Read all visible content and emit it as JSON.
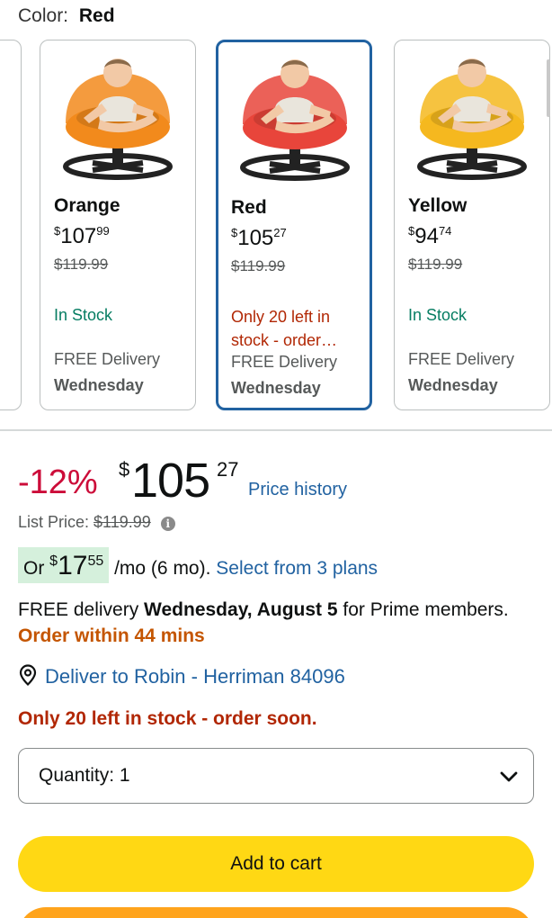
{
  "color_selector": {
    "label": "Color:",
    "selected": "Red"
  },
  "variants": [
    {
      "name": "Orange",
      "price_whole": "107",
      "price_frac": "99",
      "list_price": "$119.99",
      "stock": "In Stock",
      "delivery": "FREE Delivery",
      "day": "Wednesday",
      "seat_color": "#f28a1c"
    },
    {
      "name": "Red",
      "price_whole": "105",
      "price_frac": "27",
      "list_price": "$119.99",
      "stock": "Only 20 left in stock - order…",
      "delivery": "FREE Delivery",
      "day": "Wednesday",
      "seat_color": "#e8453b"
    },
    {
      "name": "Yellow",
      "price_whole": "94",
      "price_frac": "74",
      "list_price": "$119.99",
      "stock": "In Stock",
      "delivery": "FREE Delivery",
      "day": "Wednesday",
      "seat_color": "#f5b81f"
    }
  ],
  "currency": "$",
  "price": {
    "discount": "-12%",
    "whole": "105",
    "fraction": "27",
    "history_link": "Price history"
  },
  "list_price": {
    "label": "List Price:",
    "value": "$119.99"
  },
  "installment": {
    "prefix": "Or",
    "whole": "17",
    "fraction": "55",
    "suffix": "/mo (6 mo).",
    "link": "Select from 3 plans"
  },
  "delivery": {
    "prefix": "FREE delivery",
    "date": "Wednesday, August 5",
    "suffix": "for Prime members.",
    "urgency": "Order within 44 mins"
  },
  "deliver_to": "Deliver to Robin - Herriman 84096",
  "stock_message": "Only 20 left in stock - order soon.",
  "quantity": {
    "label": "Quantity:",
    "value": "1"
  },
  "buttons": {
    "add_to_cart": "Add to cart"
  },
  "colors": {
    "link": "#2162a1",
    "deal": "#cc0c39",
    "cart": "#ffd814",
    "buy": "#ffa41c",
    "selected_border": "#2162a1"
  }
}
